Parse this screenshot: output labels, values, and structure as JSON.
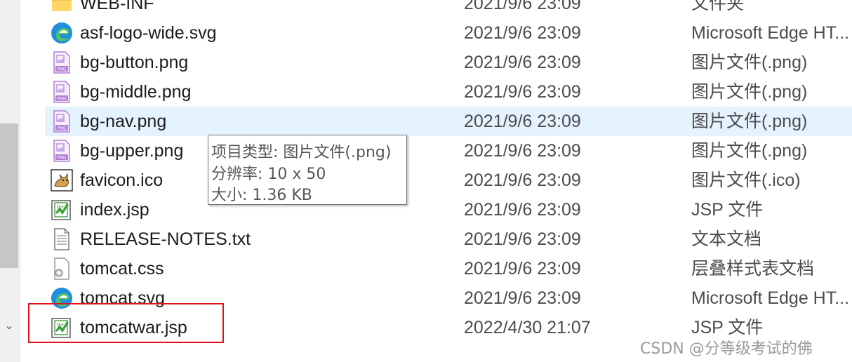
{
  "files": [
    {
      "name": "WEB-INF",
      "date": "2021/9/6 23:09",
      "type": "文件夹",
      "icon": "folder-icon"
    },
    {
      "name": "asf-logo-wide.svg",
      "date": "2021/9/6 23:09",
      "type": "Microsoft Edge HT...",
      "icon": "edge-icon"
    },
    {
      "name": "bg-button.png",
      "date": "2021/9/6 23:09",
      "type": "图片文件(.png)",
      "icon": "png-file-icon"
    },
    {
      "name": "bg-middle.png",
      "date": "2021/9/6 23:09",
      "type": "图片文件(.png)",
      "icon": "png-file-icon"
    },
    {
      "name": "bg-nav.png",
      "date": "2021/9/6 23:09",
      "type": "图片文件(.png)",
      "icon": "png-file-icon"
    },
    {
      "name": "bg-upper.png",
      "date": "2021/9/6 23:09",
      "type": "图片文件(.png)",
      "icon": "png-file-icon"
    },
    {
      "name": "favicon.ico",
      "date": "2021/9/6 23:09",
      "type": "图片文件(.ico)",
      "icon": "tomcat-icon"
    },
    {
      "name": "index.jsp",
      "date": "2021/9/6 23:09",
      "type": "JSP 文件",
      "icon": "jsp-file-icon"
    },
    {
      "name": "RELEASE-NOTES.txt",
      "date": "2021/9/6 23:09",
      "type": "文本文档",
      "icon": "text-file-icon"
    },
    {
      "name": "tomcat.css",
      "date": "2021/9/6 23:09",
      "type": "层叠样式表文档",
      "icon": "css-file-icon"
    },
    {
      "name": "tomcat.svg",
      "date": "2021/9/6 23:09",
      "type": "Microsoft Edge HT...",
      "icon": "edge-icon"
    },
    {
      "name": "tomcatwar.jsp",
      "date": "2022/4/30 21:07",
      "type": "JSP 文件",
      "icon": "jsp-file-icon"
    }
  ],
  "tooltip": {
    "line1": "项目类型: 图片文件(.png)",
    "line2": "分辨率: 10 x 50",
    "line3": "大小: 1.36 KB"
  },
  "watermark": "CSDN @分等级考试的佛",
  "colors": {
    "selection": "#e5f3ff",
    "highlight_box": "#e0121b",
    "png_icon": "#b07fd6",
    "edge_icon": "#1f8de0"
  }
}
